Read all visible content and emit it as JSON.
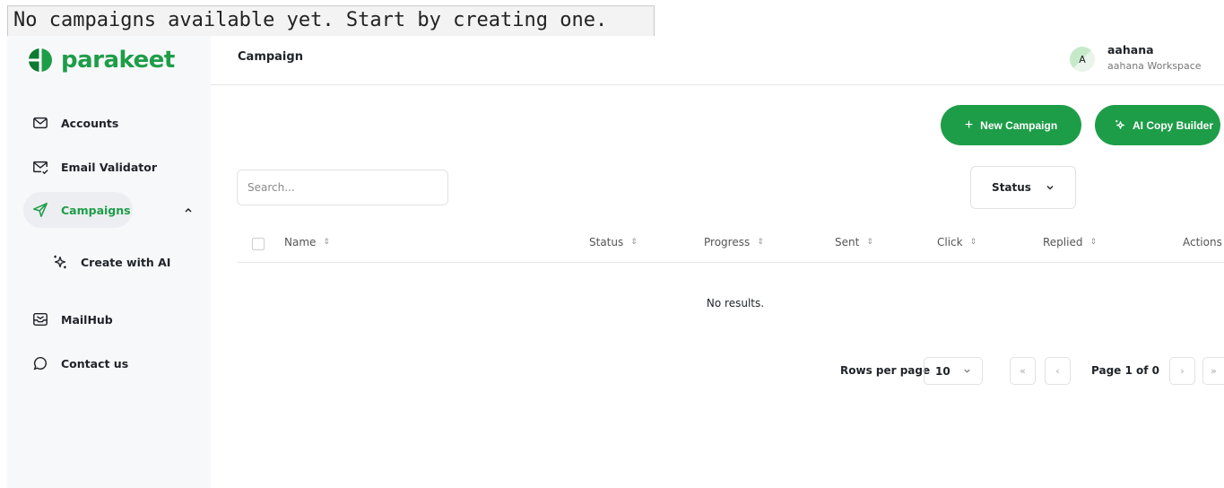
{
  "banner": {
    "text": "No campaigns available yet. Start by creating one."
  },
  "brand": {
    "name": "parakeet",
    "color": "#1e9d48"
  },
  "sidebar": {
    "items": [
      {
        "label": "Accounts",
        "icon": "mail-icon"
      },
      {
        "label": "Email Validator",
        "icon": "mail-check-icon"
      },
      {
        "label": "Campaigns",
        "icon": "send-icon",
        "active": true,
        "expanded": true
      },
      {
        "label": "Create with AI",
        "icon": "sparkles-icon"
      },
      {
        "label": "MailHub",
        "icon": "mailbox-icon"
      },
      {
        "label": "Contact us",
        "icon": "chat-bubble-icon"
      }
    ]
  },
  "header": {
    "title": "Campaign",
    "user": {
      "initial": "A",
      "name": "aahana",
      "workspace": "aahana Workspace"
    }
  },
  "toolbar": {
    "new_campaign": "New Campaign",
    "ai_copy_builder": "AI Copy Builder"
  },
  "filters": {
    "search_placeholder": "Search...",
    "status_label": "Status"
  },
  "table": {
    "columns": [
      "Name",
      "Status",
      "Progress",
      "Sent",
      "Click",
      "Replied",
      "Actions"
    ],
    "empty_text": "No results."
  },
  "pagination": {
    "rows_per_page_label": "Rows per page",
    "rows_per_page": "10",
    "page_info": "Page 1 of 0"
  }
}
